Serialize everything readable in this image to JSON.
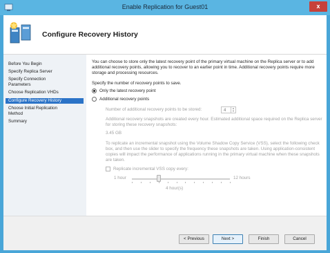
{
  "window": {
    "title": "Enable Replication for Guest01",
    "close_glyph": "x"
  },
  "header": {
    "title": "Configure Recovery History"
  },
  "nav": {
    "items": [
      {
        "label": "Before You Begin",
        "active": false
      },
      {
        "label": "Specify Replica Server",
        "active": false
      },
      {
        "label": "Specify Connection Parameters",
        "active": false
      },
      {
        "label": "Choose Replication VHDs",
        "active": false
      },
      {
        "label": "Configure Recovery History",
        "active": true
      },
      {
        "label": "Choose Initial Replication Method",
        "active": false
      },
      {
        "label": "Summary",
        "active": false
      }
    ]
  },
  "content": {
    "intro": "You can choose to store only the latest recovery point of the primary virtual machine on the Replica server or to add additional recovery points, allowing you to recover to an earlier point in time. Additional recovery points require more storage and processing resources.",
    "specify_label": "Specify the number of recovery points to save.",
    "option_latest": "Only the latest recovery point",
    "option_additional": "Additional recovery points",
    "number_label": "Number of additional recovery points to be stored:",
    "number_value": "4",
    "snapshots_text": "Additional recovery snapshots are created every hour. Estimated additional space required on the Replica server for storing these recovery snapshots:",
    "space_value": "3.45 GB",
    "vss_text": "To replicate an incremental snapshot using the Volume Shadow Copy Service (VSS), select the following check box, and then use the slider to specify the frequency these snapshots are taken. Using application-consistent copies will impact the performance of applications running in the primary virtual machine when these snapshots are taken.",
    "vss_checkbox_label": "Replicate incremental VSS copy every:",
    "slider_min": "1 hour",
    "slider_max": "12 hours",
    "slider_value_label": "4 hour(s)",
    "slider_value": 4
  },
  "buttons": {
    "previous": "< Previous",
    "next": "Next >",
    "finish": "Finish",
    "cancel": "Cancel"
  },
  "colors": {
    "titlebar": "#5ab5e2",
    "nav_active": "#2b73c7",
    "close": "#c7413a"
  },
  "icons": {
    "app": "hyper-v-icon",
    "header": "replication-wizard-icon",
    "close": "close-icon"
  }
}
